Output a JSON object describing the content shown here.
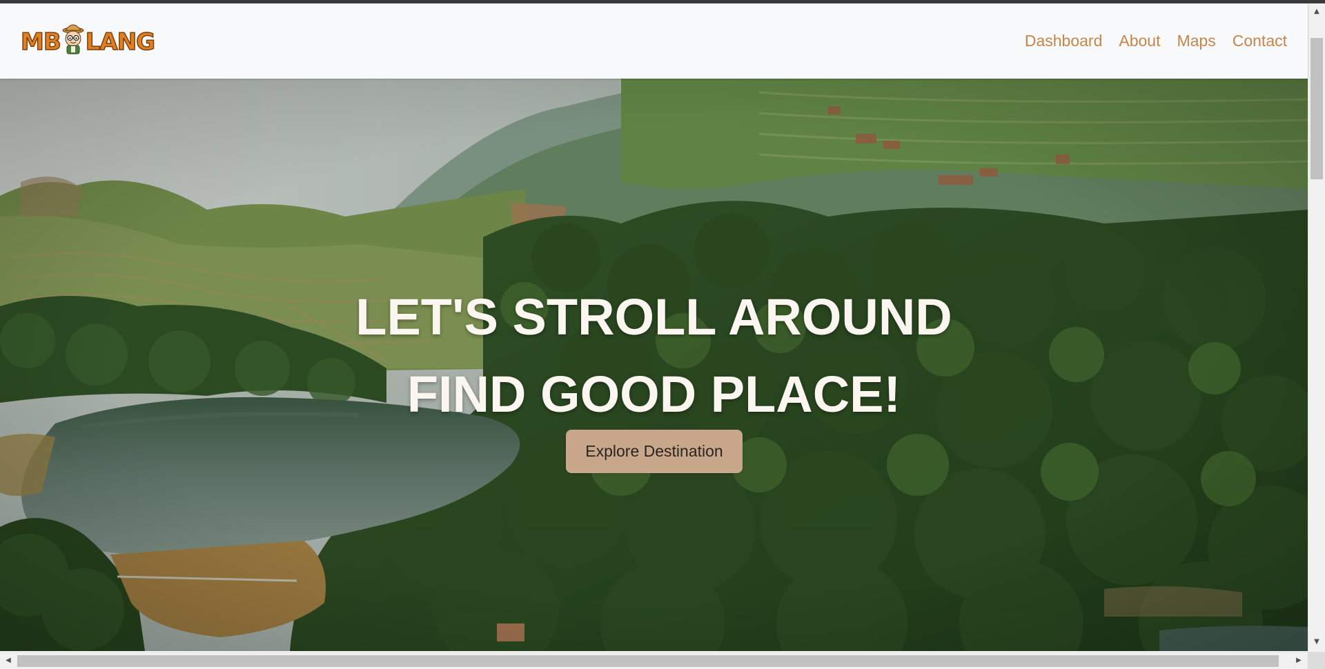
{
  "brand": {
    "logo_text_left": "MB",
    "logo_text_right": "LANG",
    "logo_colors": {
      "fill": "#e0801f",
      "outline": "#7a3d0b"
    }
  },
  "nav": {
    "links": [
      {
        "label": "Dashboard"
      },
      {
        "label": "About"
      },
      {
        "label": "Maps"
      },
      {
        "label": "Contact"
      }
    ],
    "link_color": "#c4864a"
  },
  "hero": {
    "title_line_1": "LET'S STROLL AROUND",
    "title_line_2": "FIND GOOD PLACE!",
    "cta_label": "Explore Destination",
    "cta_color": "#c8a78b",
    "background": "aerial view of forested hills, terraced farmland and a lake"
  },
  "scrollbars": {
    "up_icon": "▲",
    "down_icon": "▼",
    "left_icon": "◀",
    "right_icon": "▶"
  }
}
